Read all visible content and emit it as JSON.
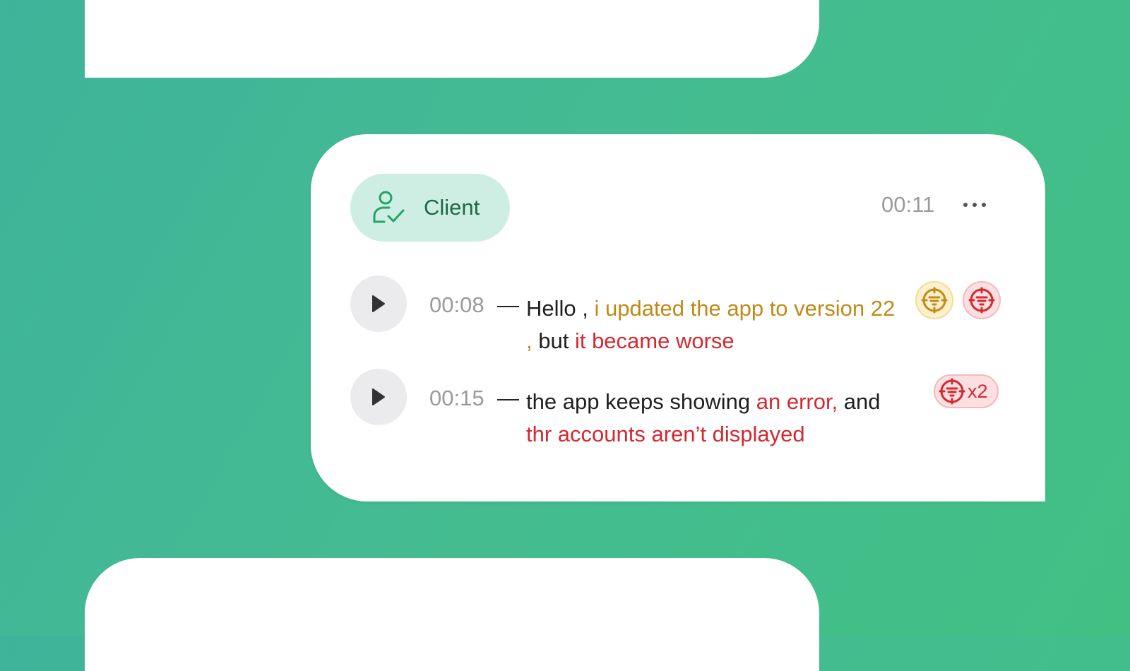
{
  "card": {
    "role_label": "Client",
    "time": "00:11",
    "menu_icon": "more-horizontal-icon"
  },
  "messages": [
    {
      "timestamp": "00:08",
      "dash": "—",
      "segments": [
        {
          "text": "Hello , ",
          "kind": "normal"
        },
        {
          "text": "i updated the app to version 22 , ",
          "kind": "warning"
        },
        {
          "text": "but ",
          "kind": "normal"
        },
        {
          "text": "it became worse",
          "kind": "error"
        }
      ],
      "tags": [
        {
          "icon": "warning-tag-icon",
          "color": "#c08a16"
        },
        {
          "icon": "error-tag-icon",
          "color": "#d3282f"
        }
      ]
    },
    {
      "timestamp": "00:15",
      "dash": "—",
      "segments": [
        {
          "text": "the app keeps showing ",
          "kind": "normal"
        },
        {
          "text": "an error,",
          "kind": "error"
        },
        {
          "text": " and ",
          "kind": "normal"
        },
        {
          "text": "thr accounts aren’t displayed",
          "kind": "error"
        }
      ],
      "tags": [
        {
          "icon": "error-tag-icon",
          "color": "#d3282f",
          "count": "x2"
        }
      ]
    }
  ],
  "colors": {
    "background_start": "#3fb39a",
    "background_end": "#41c084",
    "role_pill": "#cfeee3",
    "role_text": "#1d6b4a",
    "warning": "#c08a16",
    "error": "#d3282f"
  }
}
